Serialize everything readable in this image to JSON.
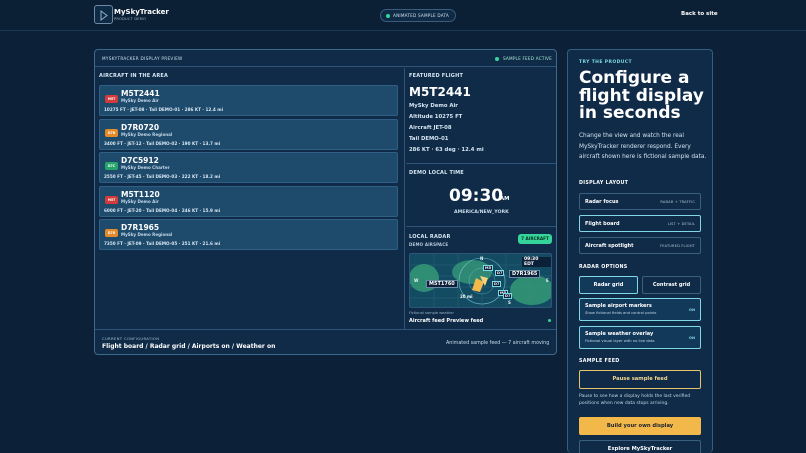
{
  "brand": {
    "name": "MySkyTracker",
    "sub": "PRODUCT DEMO"
  },
  "header": {
    "status_pill": "ANIMATED SAMPLE DATA",
    "back_link": "Back to site"
  },
  "preview": {
    "title": "MYSKYTRACKER DISPLAY PREVIEW",
    "active": "SAMPLE FEED ACTIVE",
    "list_label": "AIRCRAFT IN THE AREA",
    "aircraft": [
      {
        "badge": "M5T",
        "badge_color": "#d33b3b",
        "code": "M5T2441",
        "operator": "MySky Demo Air",
        "stats": "10275 FT · JET-08 · Tail DEMO-01 · 286 KT · 12.4 mi"
      },
      {
        "badge": "D7R",
        "badge_color": "#e38a2a",
        "code": "D7R0720",
        "operator": "MySky Demo Regional",
        "stats": "3400 FT · JET-12 · Tail DEMO-02 · 190 KT · 13.7 mi"
      },
      {
        "badge": "D7C",
        "badge_color": "#26a56b",
        "code": "D7C5912",
        "operator": "MySky Demo Charter",
        "stats": "2550 FT · JET-45 · Tail DEMO-03 · 222 KT · 18.2 mi"
      },
      {
        "badge": "M5T",
        "badge_color": "#d33b3b",
        "code": "M5T1120",
        "operator": "MySky Demo Air",
        "stats": "6000 FT · JET-20 · Tail DEMO-04 · 246 KT · 15.9 mi"
      },
      {
        "badge": "D7R",
        "badge_color": "#e38a2a",
        "code": "D7R1965",
        "operator": "MySky Demo Regional",
        "stats": "7350 FT · JET-09 · Tail DEMO-05 · 251 KT · 21.6 mi"
      }
    ],
    "featured": {
      "label": "FEATURED FLIGHT",
      "code": "M5T2441",
      "lines": [
        "MySky Demo Air",
        "Altitude 10275 FT",
        "Aircraft JET-08",
        "Tail DEMO-01",
        "286 KT · 63 deg · 12.4 mi"
      ]
    },
    "clock": {
      "label": "DEMO LOCAL TIME",
      "time": "09:30",
      "ampm": "AM",
      "tz": "AMERICA/NEW_YORK"
    },
    "radar": {
      "label": "LOCAL RADAR",
      "sub": "DEMO AIRSPACE",
      "badge": "7 AIRCRAFT",
      "time": "09:30 EDT",
      "callout_a": "D7R1965",
      "callout_b": "M5T1760",
      "range": "20 mi",
      "compass": {
        "n": "N",
        "s": "S",
        "e": "E",
        "w": "W"
      },
      "blips": [
        "M5",
        "D7",
        "D7",
        "M5",
        "D7"
      ],
      "caption": "Fictional sample weather",
      "feed": "Aircraft feed Preview feed"
    },
    "footer": {
      "label": "CURRENT CONFIGURATION",
      "value": "Flight board / Radar grid / Airports on / Weather on",
      "status": "Animated sample feed — 7 aircraft moving"
    }
  },
  "config": {
    "eyebrow": "TRY THE PRODUCT",
    "title": "Configure a flight display in seconds",
    "description": "Change the view and watch the real MySkyTracker renderer respond. Every aircraft shown here is fictional sample data.",
    "layout_label": "DISPLAY LAYOUT",
    "layouts": [
      {
        "label": "Radar focus",
        "hint": "RADAR + TRAFFIC",
        "selected": false
      },
      {
        "label": "Flight board",
        "hint": "LIST + DETAIL",
        "selected": true
      },
      {
        "label": "Aircraft spotlight",
        "hint": "FEATURED FLIGHT",
        "selected": false
      }
    ],
    "radar_label": "RADAR OPTIONS",
    "radar_grid": "Radar grid",
    "contrast_grid": "Contrast grid",
    "toggles": [
      {
        "title": "Sample airport markers",
        "sub": "Show fictional fields and control points",
        "mark": "ON"
      },
      {
        "title": "Sample weather overlay",
        "sub": "Fictional visual layer with no live data",
        "mark": "ON"
      }
    ],
    "feed_label": "SAMPLE FEED",
    "pause": "Pause sample feed",
    "pause_desc": "Pause to see how a display holds the last verified positions when new data stops arriving.",
    "build": "Build your own display",
    "explore": "Explore MySkyTracker"
  }
}
